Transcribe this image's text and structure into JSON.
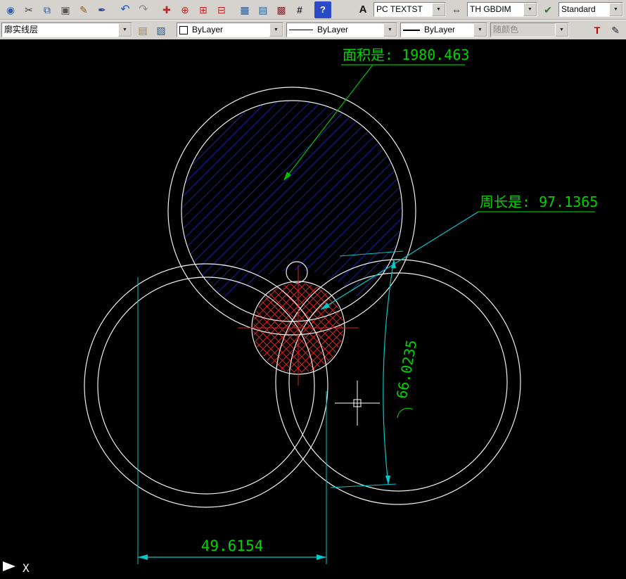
{
  "ui": {
    "dropdown_arrow": "▼"
  },
  "toolbar_top": {
    "icons": [
      {
        "name": "app-icon",
        "glyph": "◉"
      },
      {
        "name": "cut-icon",
        "glyph": "✂"
      },
      {
        "name": "copy-icon",
        "glyph": "⧉"
      },
      {
        "name": "paste-icon",
        "glyph": "▣"
      },
      {
        "name": "match-properties-icon",
        "glyph": "✎"
      },
      {
        "name": "brush-icon",
        "glyph": "✒"
      },
      {
        "name": "undo-icon",
        "glyph": "↶"
      },
      {
        "name": "redo-icon",
        "glyph": "↷"
      },
      {
        "name": "pan-icon",
        "glyph": "✚"
      },
      {
        "name": "zoom-realtime-icon",
        "glyph": "⊕"
      },
      {
        "name": "zoom-window-icon",
        "glyph": "⊞"
      },
      {
        "name": "zoom-previous-icon",
        "glyph": "⊟"
      },
      {
        "name": "layout-icon",
        "glyph": "▦"
      },
      {
        "name": "table-icon",
        "glyph": "▤"
      },
      {
        "name": "block-icon",
        "glyph": "▩"
      },
      {
        "name": "calculator-icon",
        "glyph": "#"
      },
      {
        "name": "help-icon",
        "glyph": "?"
      },
      {
        "name": "text-style-icon",
        "glyph": "A"
      },
      {
        "name": "dim-style-icon",
        "glyph": "⇔"
      },
      {
        "name": "table-style-icon",
        "glyph": "✔"
      }
    ],
    "text_style": "PC TEXTST",
    "dim_style": "TH GBDIM",
    "style": "Standard"
  },
  "toolbar_layer": {
    "layer_name": "廓实线层",
    "icons": [
      {
        "name": "layer-states-icon",
        "glyph": "▤"
      },
      {
        "name": "layers-icon",
        "glyph": "▧"
      },
      {
        "name": "text-toolbar-icon",
        "glyph": "T"
      },
      {
        "name": "style-edit-icon",
        "glyph": "✎"
      }
    ],
    "color": "ByLayer",
    "linetype": "ByLayer",
    "lineweight": "ByLayer",
    "plot_style": "随颜色"
  },
  "drawing": {
    "area_label": "面积是: 1980.463",
    "perimeter_label": "周长是: 97.1365",
    "arc_dim": "66.0235",
    "linear_dim": "49.6154",
    "ucs_x": "X"
  },
  "colors": {
    "green": "#00d400",
    "cyan": "#00c8c8",
    "hatch_blue": "#2a2ae0",
    "hatch_red": "#d02525",
    "line_white": "#f0f0f0"
  }
}
